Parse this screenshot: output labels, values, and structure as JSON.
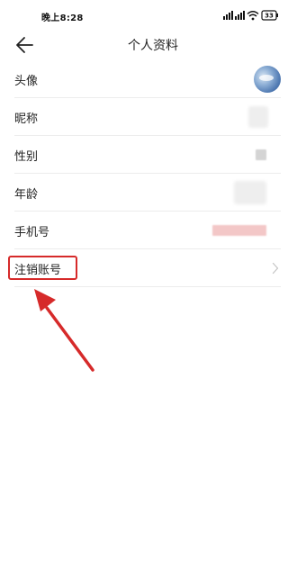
{
  "status_bar": {
    "time": "晚上8:28",
    "battery": "33"
  },
  "header": {
    "title": "个人资料",
    "back_icon": "back-arrow-icon"
  },
  "profile": {
    "rows": [
      {
        "label": "头像"
      },
      {
        "label": "昵称"
      },
      {
        "label": "性别"
      },
      {
        "label": "年龄"
      },
      {
        "label": "手机号"
      },
      {
        "label": "注销账号"
      }
    ]
  },
  "colors": {
    "annotation": "#d62a2a",
    "divider": "#ececec",
    "text": "#222222"
  }
}
